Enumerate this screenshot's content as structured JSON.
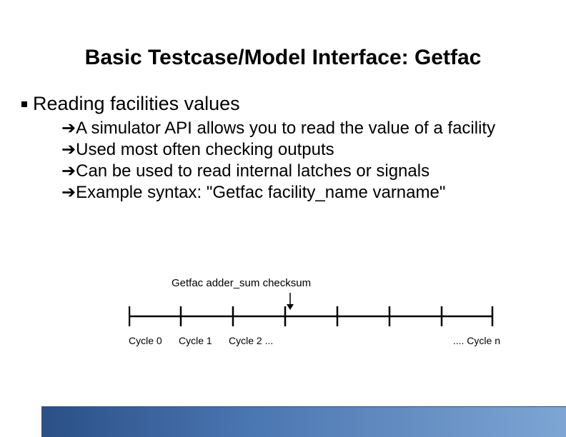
{
  "title": "Basic Testcase/Model Interface: Getfac",
  "heading": "Reading facilities values",
  "sub_bullets": [
    "A simulator API allows you to read the value of a facility",
    "Used most often checking outputs",
    "Can be used to read internal latches or signals",
    "Example syntax:  \"Getfac facility_name varname\""
  ],
  "figure": {
    "caption": "Getfac adder_sum checksum",
    "cycles_left": [
      "Cycle 0",
      "Cycle 1",
      "Cycle 2  ..."
    ],
    "cycles_right": ".... Cycle n"
  }
}
